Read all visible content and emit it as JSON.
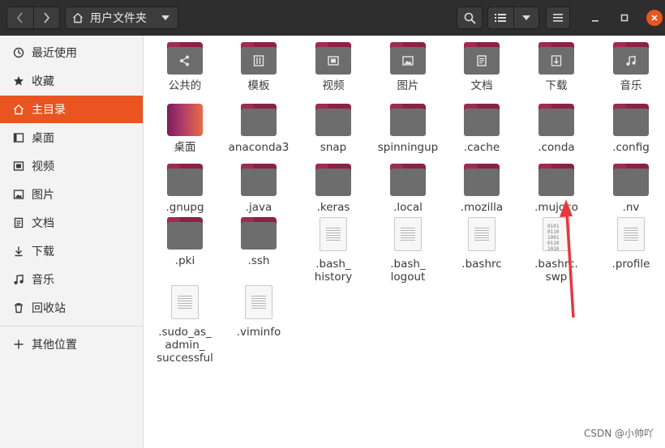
{
  "header": {
    "location": "用户文件夹",
    "icons": {
      "back": "chevron-left-icon",
      "forward": "chevron-right-icon",
      "home": "home-icon",
      "location_menu": "caret-down-icon",
      "search": "search-icon",
      "list_view": "list-view-icon",
      "view_options": "caret-down-icon",
      "menu": "hamburger-menu-icon",
      "minimize": "minimize-icon",
      "maximize": "maximize-icon",
      "close": "close-icon"
    }
  },
  "sidebar": {
    "items": [
      {
        "label": "最近使用",
        "icon": "recent-icon"
      },
      {
        "label": "收藏",
        "icon": "star-icon"
      },
      {
        "label": "主目录",
        "icon": "home-icon",
        "active": true
      },
      {
        "label": "桌面",
        "icon": "desktop-icon"
      },
      {
        "label": "视频",
        "icon": "video-icon"
      },
      {
        "label": "图片",
        "icon": "pictures-icon"
      },
      {
        "label": "文档",
        "icon": "documents-icon"
      },
      {
        "label": "下载",
        "icon": "download-icon"
      },
      {
        "label": "音乐",
        "icon": "music-icon"
      },
      {
        "label": "回收站",
        "icon": "trash-icon"
      },
      {
        "label": "其他位置",
        "icon": "plus-icon"
      }
    ]
  },
  "files": [
    {
      "name": "公共的",
      "type": "folder",
      "emblem": "share"
    },
    {
      "name": "模板",
      "type": "folder",
      "emblem": "template"
    },
    {
      "name": "视频",
      "type": "folder",
      "emblem": "video"
    },
    {
      "name": "图片",
      "type": "folder",
      "emblem": "pictures"
    },
    {
      "name": "文档",
      "type": "folder",
      "emblem": "documents"
    },
    {
      "name": "下载",
      "type": "folder",
      "emblem": "download"
    },
    {
      "name": "音乐",
      "type": "folder",
      "emblem": "music"
    },
    {
      "name": "桌面",
      "type": "desktop"
    },
    {
      "name": "anaconda3",
      "type": "folder"
    },
    {
      "name": "snap",
      "type": "folder"
    },
    {
      "name": "spinningup",
      "type": "folder"
    },
    {
      "name": ".cache",
      "type": "folder"
    },
    {
      "name": ".conda",
      "type": "folder"
    },
    {
      "name": ".config",
      "type": "folder"
    },
    {
      "name": ".gnupg",
      "type": "folder"
    },
    {
      "name": ".java",
      "type": "folder"
    },
    {
      "name": ".keras",
      "type": "folder"
    },
    {
      "name": ".local",
      "type": "folder"
    },
    {
      "name": ".mozilla",
      "type": "folder"
    },
    {
      "name": ".mujoco",
      "type": "folder"
    },
    {
      "name": ".nv",
      "type": "folder"
    },
    {
      "name": ".pki",
      "type": "folder"
    },
    {
      "name": ".ssh",
      "type": "folder"
    },
    {
      "name": ".bash_\nhistory",
      "type": "text"
    },
    {
      "name": ".bash_\nlogout",
      "type": "text"
    },
    {
      "name": ".bashrc",
      "type": "text"
    },
    {
      "name": ".bashrc.\nswp",
      "type": "binary"
    },
    {
      "name": ".profile",
      "type": "text"
    },
    {
      "name": ".sudo_as_\nadmin_\nsuccessful",
      "type": "text"
    },
    {
      "name": ".viminfo",
      "type": "text"
    }
  ],
  "annotation": {
    "color": "#e8383d"
  },
  "watermark": "CSDN @小帅吖",
  "colors": {
    "accent": "#e95420",
    "folder_body": "#6d6d6d",
    "folder_tab": "#8c2146"
  }
}
